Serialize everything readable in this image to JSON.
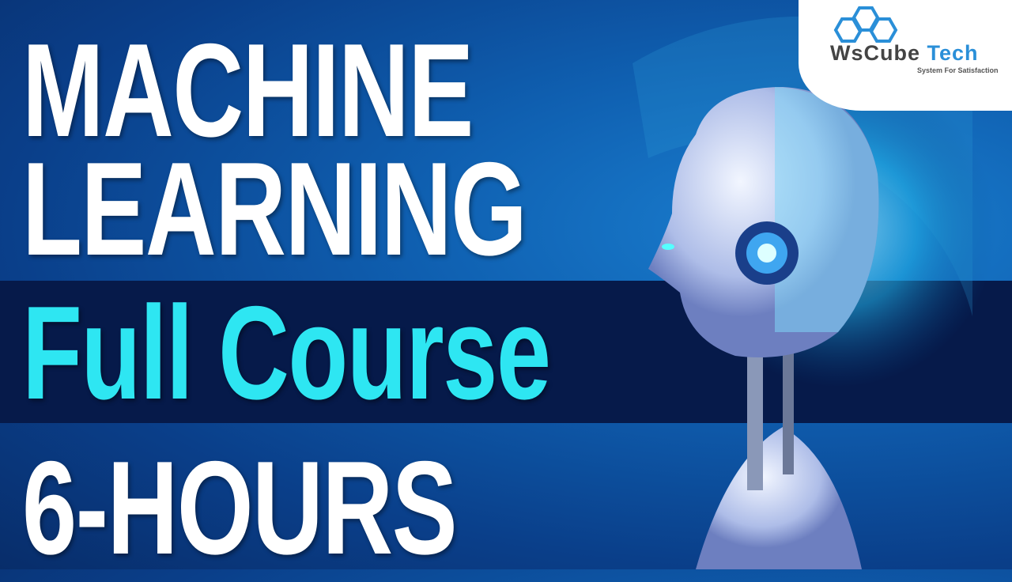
{
  "title": {
    "line1": "MACHINE",
    "line2": "LEARNING",
    "line3": "Full Course",
    "line4": "6-HOURS"
  },
  "logo": {
    "name_part1": "WsCube",
    "name_part2": "Tech",
    "tagline": "System For Satisfaction"
  },
  "colors": {
    "accent": "#2ee6f2",
    "background": "#0f5fb0",
    "band": "#061a4a",
    "logo_blue": "#2a8fd8"
  },
  "image": "robot-head-illustration"
}
